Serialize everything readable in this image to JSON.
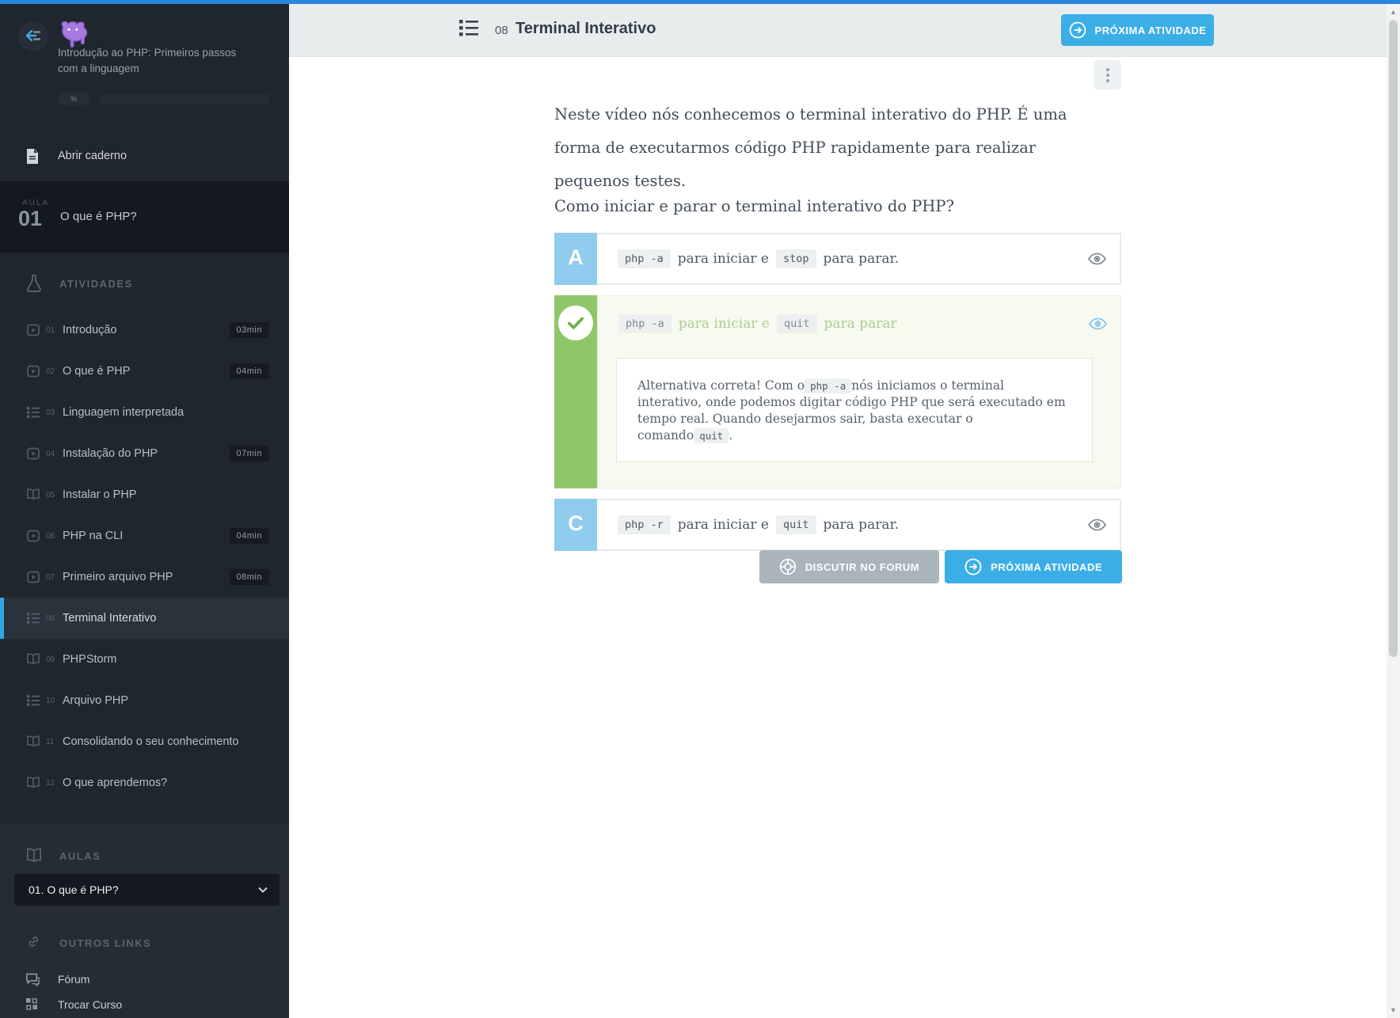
{
  "colors": {
    "topbar_blue": "#2886dd",
    "accent_blue": "#3caee6",
    "success_green": "#90c569",
    "option_blue": "#8fccee",
    "brand_purple": "#a678e0",
    "sidebar_bg": "#20262d"
  },
  "sidebar": {
    "course_title": "Introdução ao PHP: Primeiros passos com a linguagem",
    "progress_label": "%",
    "notebook_label": "Abrir caderno",
    "lesson_banner": {
      "kicker": "AULA",
      "number": "01",
      "title": "O que é PHP?"
    },
    "activities_header": "ATIVIDADES",
    "activities": [
      {
        "num": "01",
        "label": "Introdução",
        "type": "video",
        "time": "03min",
        "active": false
      },
      {
        "num": "02",
        "label": "O que é PHP",
        "type": "video",
        "time": "04min",
        "active": false
      },
      {
        "num": "03",
        "label": "Linguagem interpretada",
        "type": "quiz",
        "time": "",
        "active": false
      },
      {
        "num": "04",
        "label": "Instalação do PHP",
        "type": "video",
        "time": "07min",
        "active": false
      },
      {
        "num": "05",
        "label": "Instalar o PHP",
        "type": "reading",
        "time": "",
        "active": false
      },
      {
        "num": "06",
        "label": "PHP na CLI",
        "type": "video",
        "time": "04min",
        "active": false
      },
      {
        "num": "07",
        "label": "Primeiro arquivo PHP",
        "type": "video",
        "time": "08min",
        "active": false
      },
      {
        "num": "08",
        "label": "Terminal Interativo",
        "type": "quiz",
        "time": "",
        "active": true
      },
      {
        "num": "09",
        "label": "PHPStorm",
        "type": "reading",
        "time": "",
        "active": false
      },
      {
        "num": "10",
        "label": "Arquivo PHP",
        "type": "quiz",
        "time": "",
        "active": false
      },
      {
        "num": "11",
        "label": "Consolidando o seu conhecimento",
        "type": "reading",
        "time": "",
        "active": false
      },
      {
        "num": "12",
        "label": "O que aprendemos?",
        "type": "reading",
        "time": "",
        "active": false
      }
    ],
    "aulas_header": "AULAS",
    "lesson_select_value": "01. O que é PHP?",
    "other_links_header": "OUTROS LINKS",
    "links": [
      {
        "id": "forum",
        "label": "Fórum"
      },
      {
        "id": "switch",
        "label": "Trocar Curso"
      }
    ]
  },
  "header": {
    "activity_number": "08",
    "title": "Terminal Interativo",
    "next_button_label": "PRÓXIMA ATIVIDADE"
  },
  "question": {
    "intro": "Neste vídeo nós conhecemos o terminal interativo do PHP. É uma forma de executarmos código PHP rapidamente para realizar pequenos testes.",
    "prompt": "Como iniciar e parar o terminal interativo do PHP?",
    "options": [
      {
        "letter": "A",
        "state": "default",
        "segments": [
          {
            "code": "php -a"
          },
          {
            "text": "para iniciar e"
          },
          {
            "code": "stop"
          },
          {
            "text": "para parar."
          }
        ]
      },
      {
        "letter": "",
        "state": "correct",
        "segments": [
          {
            "code": "php -a"
          },
          {
            "text": "para iniciar e"
          },
          {
            "code": "quit"
          },
          {
            "text": "para parar"
          }
        ],
        "feedback": [
          {
            "text": "Alternativa correta! Com o"
          },
          {
            "code": "php -a"
          },
          {
            "text": "nós iniciamos o terminal interativo, onde podemos digitar código PHP que será executado em tempo real. Quando desejarmos sair, basta executar o comando"
          },
          {
            "code": "quit"
          },
          {
            "text": "."
          }
        ]
      },
      {
        "letter": "C",
        "state": "default",
        "segments": [
          {
            "code": "php -r"
          },
          {
            "text": "para iniciar e"
          },
          {
            "code": "quit"
          },
          {
            "text": "para parar."
          }
        ]
      }
    ]
  },
  "footer": {
    "forum_button_label": "DISCUTIR NO FORUM",
    "next_button_label": "PRÓXIMA ATIVIDADE"
  }
}
